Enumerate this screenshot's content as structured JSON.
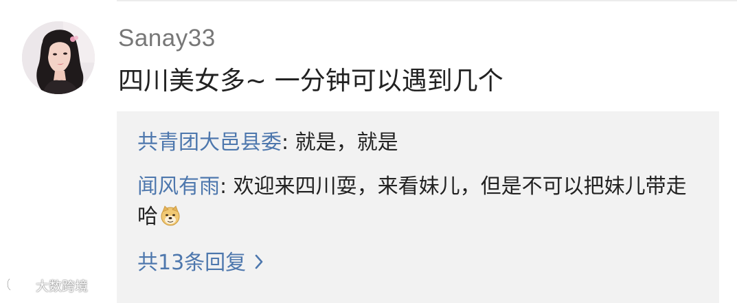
{
  "comment": {
    "username": "Sanay33",
    "text": "四川美女多~ 一分钟可以遇到几个"
  },
  "replies": [
    {
      "author": "共青团大邑县委",
      "separator": ": ",
      "text": "就是，就是"
    },
    {
      "author": "闻风有雨",
      "separator": ": ",
      "text": "欢迎来四川耍，来看妹儿，但是不可以把妹儿带走哈",
      "emoji": "doge-icon"
    }
  ],
  "more_replies_label": "共13条回复",
  "watermark": "大数跨境",
  "colors": {
    "link_blue": "#4d77ad",
    "reply_bg": "#f2f2f2",
    "username_gray": "#777777"
  }
}
